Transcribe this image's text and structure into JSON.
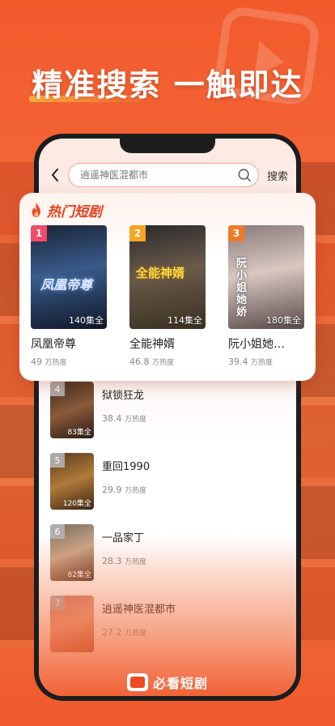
{
  "headline": "精准搜索 一触即达",
  "search": {
    "placeholder": "逍遥神医混都市",
    "button_label": "搜索"
  },
  "hot": {
    "title": "热门短剧",
    "items": [
      {
        "rank": "1",
        "name": "凤凰帝尊",
        "episodes": "140集全",
        "heat": "49",
        "heat_unit": "万热度",
        "rank_color": "#f24a6a",
        "poster_art": "凤凰帝尊"
      },
      {
        "rank": "2",
        "name": "全能神婿",
        "episodes": "114集全",
        "heat": "46.8",
        "heat_unit": "万热度",
        "rank_color": "#f6a623",
        "poster_art": "全能神婿"
      },
      {
        "rank": "3",
        "name": "阮小姐她…",
        "episodes": "180集全",
        "heat": "39.4",
        "heat_unit": "万热度",
        "rank_color": "#f07a2a",
        "poster_art": "阮小姐她娇"
      }
    ]
  },
  "list": [
    {
      "rank": "4",
      "title": "狱锁狂龙",
      "episodes": "83集全",
      "heat": "38.4",
      "heat_unit": "万热度"
    },
    {
      "rank": "5",
      "title": "重回1990",
      "episodes": "120集全",
      "heat": "29.9",
      "heat_unit": "万热度"
    },
    {
      "rank": "6",
      "title": "一品家丁",
      "episodes": "82集全",
      "heat": "28.3",
      "heat_unit": "万热度"
    },
    {
      "rank": "7",
      "title": "逍遥神医混都市",
      "episodes": "",
      "heat": "27.2",
      "heat_unit": "万热度"
    }
  ],
  "brand": {
    "name": "必看短剧"
  },
  "colors": {
    "accent": "#ef4a24",
    "background": "#f25a2c"
  }
}
